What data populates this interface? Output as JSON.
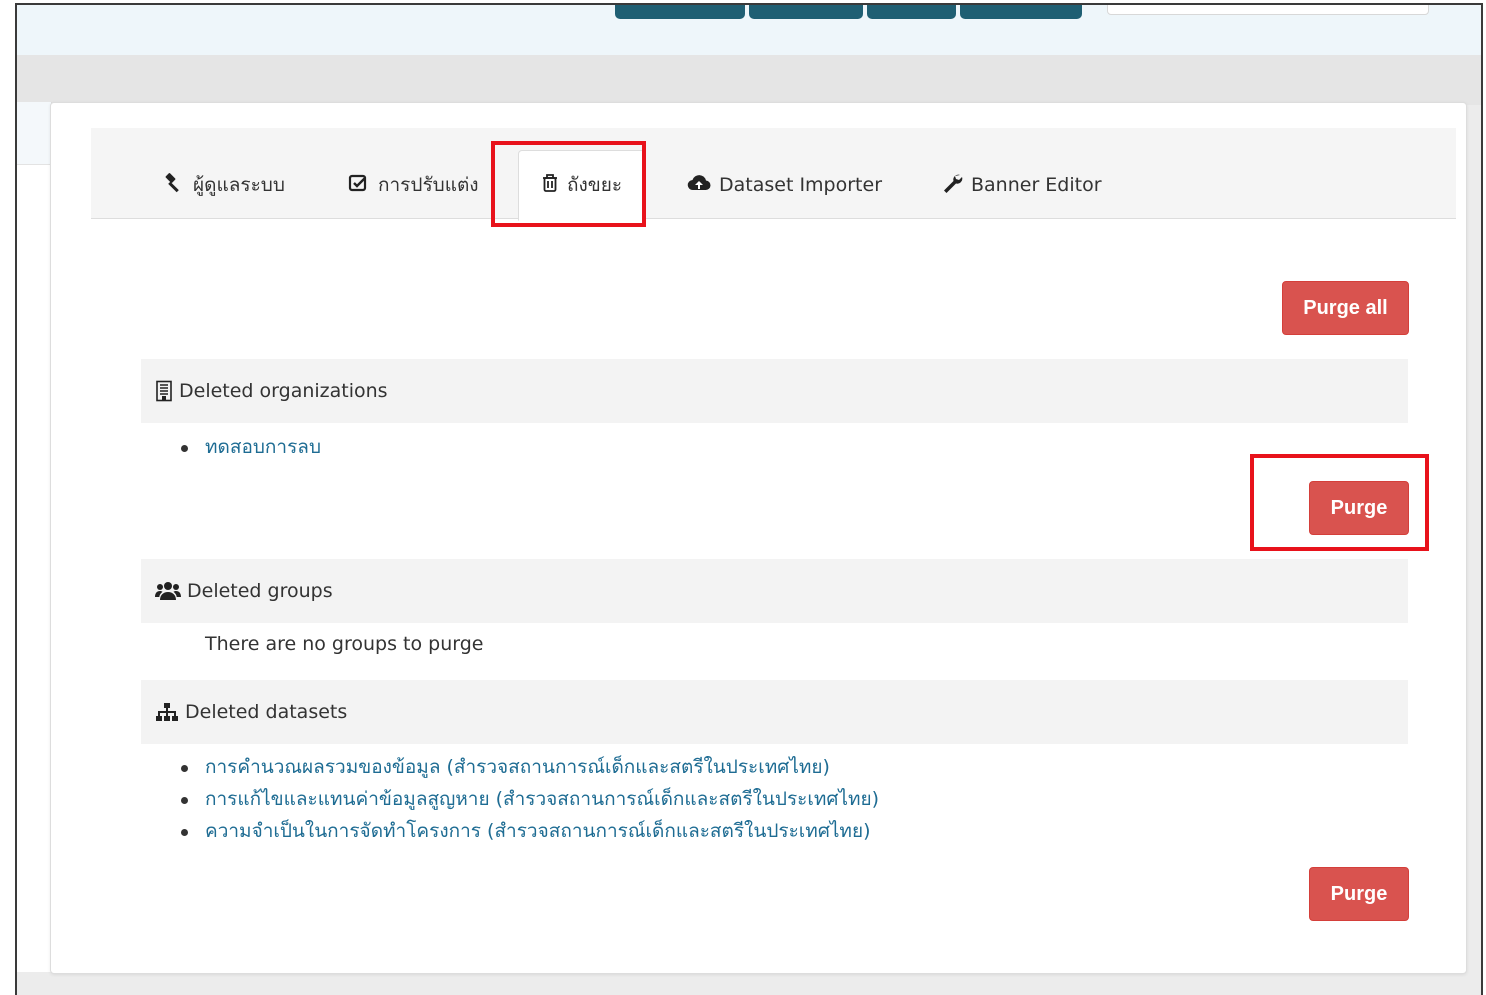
{
  "tabs": [
    {
      "label": "ผู้ดูแลระบบ",
      "icon": "gavel-icon",
      "active": false
    },
    {
      "label": "การปรับแต่ง",
      "icon": "check-square-icon",
      "active": false
    },
    {
      "label": "ถังขยะ",
      "icon": "trash-icon",
      "active": true
    },
    {
      "label": "Dataset Importer",
      "icon": "cloud-upload-icon",
      "active": false
    },
    {
      "label": "Banner Editor",
      "icon": "wrench-icon",
      "active": false
    }
  ],
  "actions": {
    "purge_all_label": "Purge all"
  },
  "sections": {
    "organizations": {
      "heading": "Deleted organizations",
      "icon": "building-icon",
      "items": [
        "ทดสอบการลบ"
      ],
      "purge_label": "Purge"
    },
    "groups": {
      "heading": "Deleted groups",
      "icon": "users-icon",
      "empty_message": "There are no groups to purge"
    },
    "datasets": {
      "heading": "Deleted datasets",
      "icon": "sitemap-icon",
      "items": [
        "การคำนวณผลรวมของข้อมูล (สำรวจสถานการณ์เด็กและสตรีในประเทศไทย)",
        "การแก้ไขและแทนค่าข้อมูลสูญหาย (สำรวจสถานการณ์เด็กและสตรีในประเทศไทย)",
        "ความจำเป็นในการจัดทำโครงการ (สำรวจสถานการณ์เด็กและสตรีในประเทศไทย)"
      ],
      "purge_label": "Purge"
    }
  },
  "colors": {
    "danger": "#d9534f",
    "link": "#1e6c93",
    "highlight": "#e8121b",
    "nav_button": "#1f5f73"
  }
}
